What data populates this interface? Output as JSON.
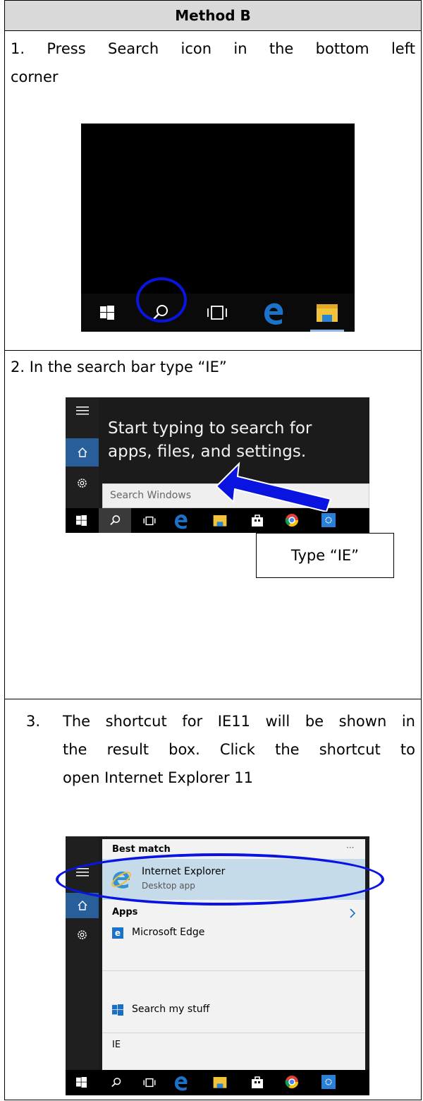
{
  "header": {
    "title": "Method B"
  },
  "step1": {
    "line1": "1. Press Search icon in the bottom left",
    "line2": "corner"
  },
  "step2": {
    "text": "2.    In the search bar type “IE”",
    "prompt_line1": "Start typing to search for",
    "prompt_line2": "apps, files, and settings.",
    "search_placeholder": "Search Windows",
    "callout": "Type “IE”"
  },
  "step3": {
    "number": "3.",
    "line1": "The shortcut for IE11 will be shown in",
    "line2": "the result box. Click the shortcut to",
    "line3": "open Internet Explorer 11",
    "best_match": "Best match",
    "more": "···",
    "app_name": "Internet Explorer",
    "app_type": "Desktop app",
    "apps_label": "Apps",
    "edge": "Microsoft Edge",
    "search_stuff": "Search my stuff",
    "query": "IE"
  },
  "colors": {
    "highlight_blue": "#0a14e0",
    "windows_blue": "#285f9a",
    "edge_blue": "#1a73c8",
    "folder_yellow": "#f3c43a"
  },
  "icons": [
    "windows-icon",
    "search-icon",
    "task-view-icon",
    "edge-icon",
    "file-explorer-icon",
    "store-icon",
    "chrome-icon",
    "settings-app-icon",
    "hamburger-icon",
    "home-icon",
    "gear-icon",
    "ie-icon",
    "chevron-right-icon",
    "arrow-icon"
  ]
}
